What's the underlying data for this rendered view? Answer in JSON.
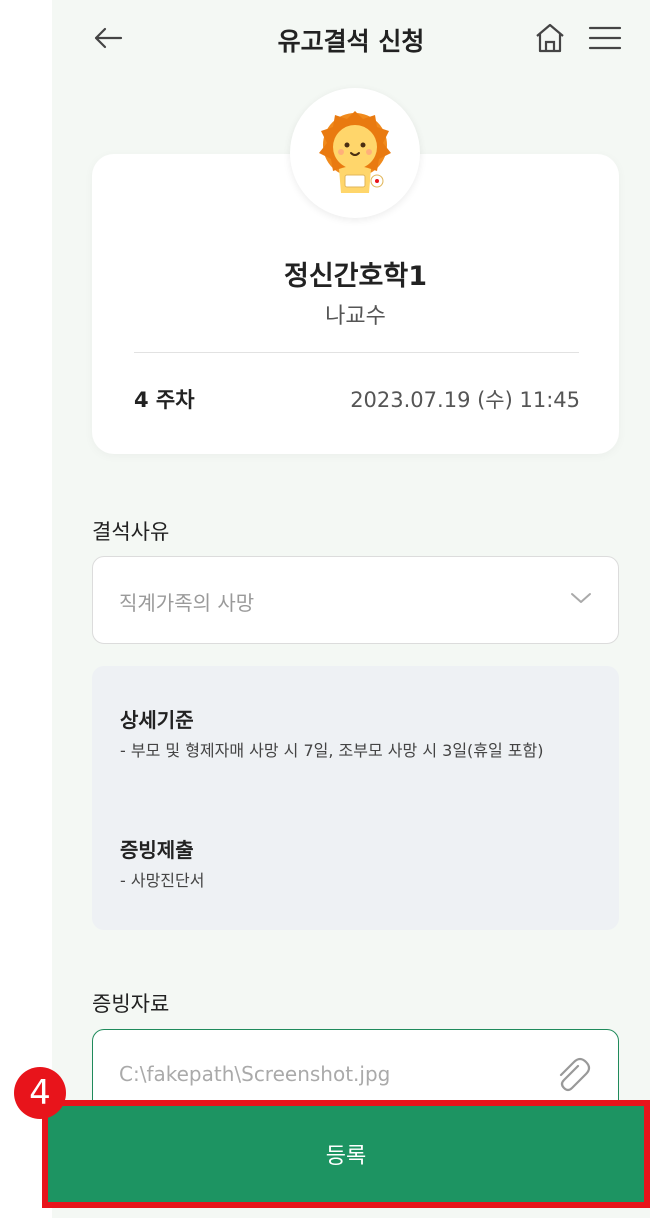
{
  "header": {
    "title": "유고결석 신청",
    "back_icon": "arrow-left-icon",
    "home_icon": "home-icon",
    "menu_icon": "hamburger-menu-icon"
  },
  "course": {
    "name": "정신간호학1",
    "professor": "나교수",
    "week": "4 주차",
    "datetime": "2023.07.19 (수) 11:45",
    "avatar_icon": "lion-mascot-icon"
  },
  "reason": {
    "label": "결석사유",
    "selected": "직계가족의 사망"
  },
  "detail": {
    "criteria_title": "상세기준",
    "criteria_text": "- 부모 및 형제자매 사망 시 7일, 조부모 사망 시 3일(휴일 포함)",
    "proof_title": "증빙제출",
    "proof_text": "- 사망진단서"
  },
  "evidence": {
    "label": "증빙자료",
    "file_value": "C:\\fakepath\\Screenshot.jpg",
    "attach_icon": "paperclip-icon"
  },
  "submit": {
    "label": "등록"
  },
  "annotation": {
    "step": "4"
  },
  "colors": {
    "primary_green": "#1d9462",
    "highlight_red": "#e8141b",
    "background": "#f4f8f4"
  }
}
